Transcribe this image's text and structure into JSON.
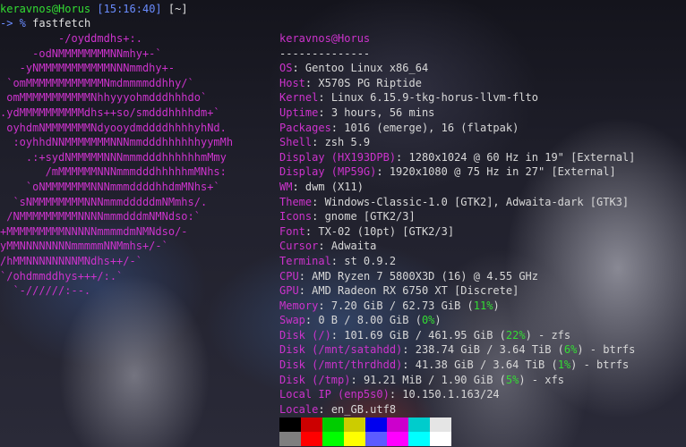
{
  "prompt": {
    "user_host": "keravnos@Horus",
    "time": "[15:16:40]",
    "cwd": "[~]",
    "marker": "-> %",
    "command": "fastfetch"
  },
  "logo": [
    "         -/oyddmdhs+:.",
    "     -odNMMMMMMMMNNmhy+-`",
    "   -yNMMMMMMMMMMMNNNmmdhy+-",
    " `omMMMMMMMMMMMMNmdmmmmddhhy/`",
    " omMMMMMMMMMMMNhhyyyohmdddhhhdo`",
    ".ydMMMMMMMMMMdhs++so/smdddhhhhdm+`",
    " oyhdmNMMMMMMMNdyooydmddddhhhhyhNd.",
    "  :oyhhdNNMMMMMMMNNNmmdddhhhhhhyymMh",
    "    .:+sydNMMMMMNNNmmmdddhhhhhhmMmy",
    "       /mMMMMMMNNNmmmdddhhhhhmMNhs:",
    "    `oNMMMMMMMNNNmmmddddhhdmMNhs+`",
    "  `sNMMMMMMMMNNNmmmdddddmNMmhs/.",
    " /NMMMMMMMMMNNNNmmmdddmNMNdso:`",
    "+MMMMMMMMMNNNNNmmmmdmNMNdso/-",
    "yMMNNNNNNNNmmmmmNNMmhs+/-`",
    "/hMMNNNNNNNNMNdhs++/-`",
    "`/ohdmmddhys+++/:.`",
    "  `-//////:--."
  ],
  "info": {
    "title": "keravnos@Horus",
    "separator": "--------------",
    "rows": [
      {
        "key": "OS",
        "value": "Gentoo Linux x86_64"
      },
      {
        "key": "Host",
        "value": "X570S PG Riptide"
      },
      {
        "key": "Kernel",
        "value": "Linux 6.15.9-tkg-horus-llvm-flto"
      },
      {
        "key": "Uptime",
        "value": "3 hours, 56 mins"
      },
      {
        "key": "Packages",
        "value": "1016 (emerge), 16 (flatpak)"
      },
      {
        "key": "Shell",
        "value": "zsh 5.9"
      },
      {
        "key": "Display (HX193DPB)",
        "value": "1280x1024 @ 60 Hz in 19\" [External]"
      },
      {
        "key": "Display (MP59G)",
        "value": "1920x1080 @ 75 Hz in 27\" [External]"
      },
      {
        "key": "WM",
        "value": "dwm (X11)"
      },
      {
        "key": "Theme",
        "value": "Windows-Classic-1.0 [GTK2], Adwaita-dark [GTK3]"
      },
      {
        "key": "Icons",
        "value": "gnome [GTK2/3]"
      },
      {
        "key": "Font",
        "value": "TX-02 (10pt) [GTK2/3]"
      },
      {
        "key": "Cursor",
        "value": "Adwaita"
      },
      {
        "key": "Terminal",
        "value": "st 0.9.2"
      },
      {
        "key": "CPU",
        "value": "AMD Ryzen 7 5800X3D (16) @ 4.55 GHz"
      },
      {
        "key": "GPU",
        "value": "AMD Radeon RX 6750 XT [Discrete]"
      },
      {
        "key": "Memory",
        "value": "7.20 GiB / 62.73 GiB (",
        "pct": "11%",
        "tail": ")"
      },
      {
        "key": "Swap",
        "value": "0 B / 8.00 GiB (",
        "pct": "0%",
        "tail": ")"
      },
      {
        "key": "Disk (/)",
        "value": "101.69 GiB / 461.95 GiB (",
        "pct": "22%",
        "tail": ") - zfs"
      },
      {
        "key": "Disk (/mnt/satahdd)",
        "value": "238.74 GiB / 3.64 TiB (",
        "pct": "6%",
        "tail": ") - btrfs"
      },
      {
        "key": "Disk (/mnt/thrdhdd)",
        "value": "41.38 GiB / 3.64 TiB (",
        "pct": "1%",
        "tail": ") - btrfs"
      },
      {
        "key": "Disk (/tmp)",
        "value": "91.21 MiB / 1.90 GiB (",
        "pct": "5%",
        "tail": ") - xfs"
      },
      {
        "key": "Local IP (enp5s0)",
        "value": "10.150.1.163/24"
      },
      {
        "key": "Locale",
        "value": "en_GB.utf8"
      }
    ]
  },
  "colors": {
    "key": "#cc33cc",
    "percent": "#33dd33",
    "palette_top": [
      "#000000",
      "#cc0000",
      "#00cc00",
      "#cccc00",
      "#0000ee",
      "#cc00cc",
      "#00cccc",
      "#e5e5e5"
    ],
    "palette_bottom": [
      "#7f7f7f",
      "#ff0000",
      "#00ff00",
      "#ffff00",
      "#5c5cff",
      "#ff00ff",
      "#00ffff",
      "#ffffff"
    ]
  }
}
